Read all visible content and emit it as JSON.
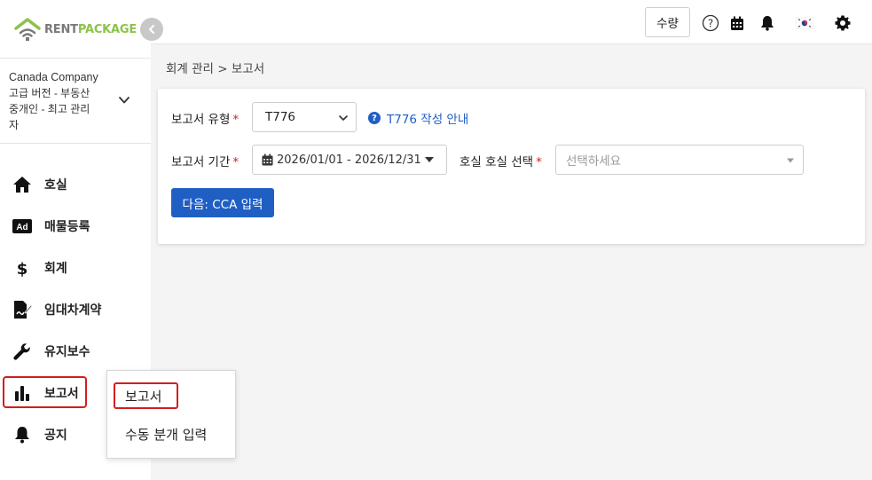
{
  "brand": {
    "logo_rent": "RENT",
    "logo_package": "PACKAGE",
    "green": "#8bc34a",
    "gray": "#7a7a7a"
  },
  "company": {
    "name": "Canada Company",
    "role_line1": "고급 버전 - 부동산",
    "role_line2": "중개인 - 최고 관리",
    "role_line3": "자"
  },
  "sidebar": {
    "items": [
      {
        "label": "호실",
        "icon": "home-icon"
      },
      {
        "label": "매물등록",
        "icon": "ad-icon"
      },
      {
        "label": "회계",
        "icon": "dollar-icon"
      },
      {
        "label": "임대차계약",
        "icon": "contract-sign-icon"
      },
      {
        "label": "유지보수",
        "icon": "wrench-icon"
      },
      {
        "label": "보고서",
        "icon": "bar-chart-icon"
      },
      {
        "label": "공지",
        "icon": "bell-icon"
      }
    ],
    "active_index": 5
  },
  "submenu": {
    "items": [
      {
        "label": "보고서"
      },
      {
        "label": "수동 분개 입력"
      }
    ]
  },
  "topbar": {
    "qty_label": "수량",
    "icons": [
      "help-circle-icon",
      "calendar-icon",
      "bell-icon",
      "korea-flag-icon",
      "gear-icon"
    ]
  },
  "breadcrumb": "회계 관리 > 보고서",
  "form": {
    "report_type_label": "보고서 유형",
    "report_type_value": "T776",
    "help_text": "T776 작성 안내",
    "period_label": "보고서 기간",
    "period_value": "2026/01/01 - 2026/12/31",
    "unit_label": "호실 호실 선택",
    "unit_placeholder": "선택하세요",
    "required_mark": "*",
    "next_button": "다음: CCA 입력"
  },
  "colors": {
    "accent": "#1f5fc4",
    "highlight": "#d21e1e",
    "required": "#d21e1e"
  }
}
